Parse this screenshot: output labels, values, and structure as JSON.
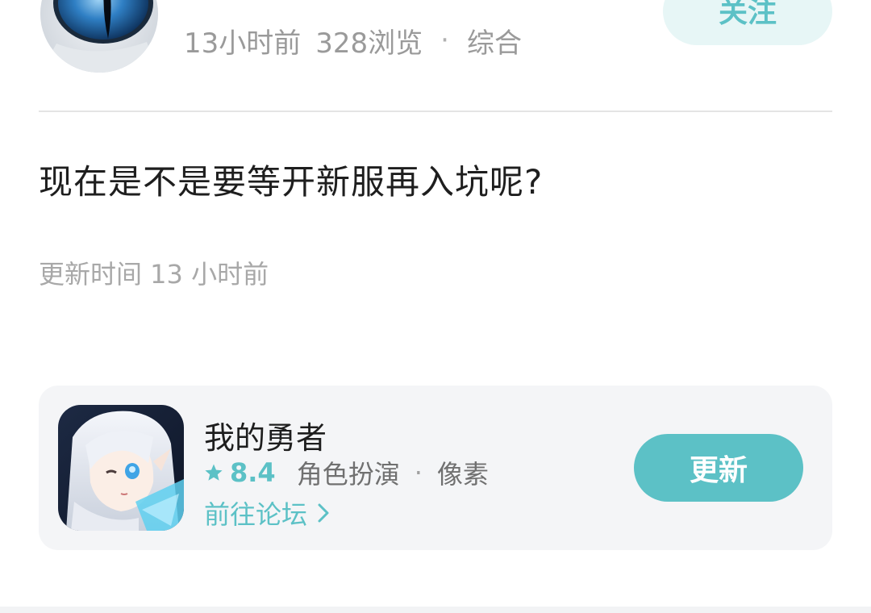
{
  "author": {
    "name": "",
    "time_ago": "13小时前",
    "views": "328浏览",
    "separator": "·",
    "category": "综合",
    "follow_label": "关注"
  },
  "post": {
    "title": "现在是不是要等开新服再入坑呢?",
    "updated": "更新时间 13 小时前"
  },
  "game": {
    "name": "我的勇者",
    "rating": "8.4",
    "genre_1": "角色扮演",
    "separator": "·",
    "genre_2": "像素",
    "forum_link": "前往论坛",
    "update_label": "更新"
  },
  "icons": {
    "avatar": "blue-eye-avatar",
    "game": "game-character-icon",
    "star": "star-icon",
    "chevron": "chevron-right-icon"
  },
  "colors": {
    "accent": "#5cc1c6",
    "follow_bg": "#e7f6f6",
    "card_bg": "#f4f5f7",
    "muted_text": "#9a9a9a"
  }
}
